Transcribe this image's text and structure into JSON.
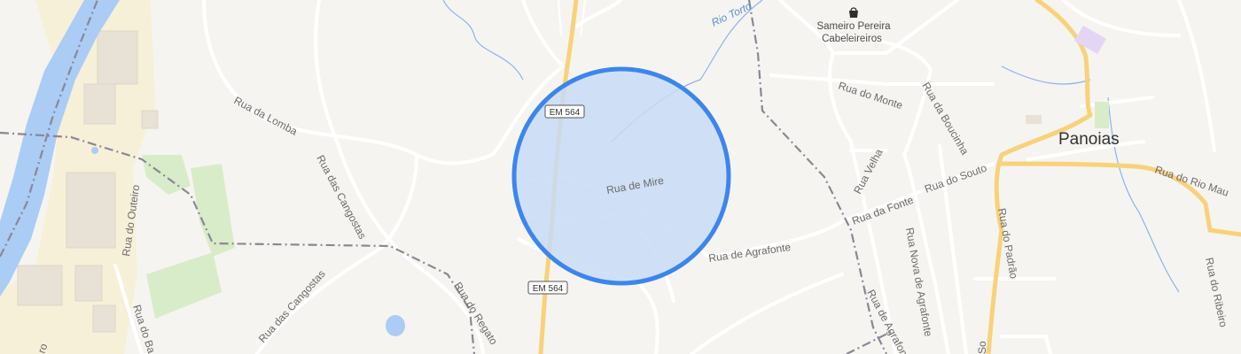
{
  "map": {
    "place_label": "Panoias",
    "poi": {
      "icon": "shopping-bag-icon",
      "name_line1": "Sameiro Pereira",
      "name_line2": "Cabeleireiros"
    },
    "road_shield": "EM 564",
    "water_label": "Rio Torto",
    "streets": {
      "rua_de_mire": "Rua de Mire",
      "rua_da_lomba": "Rua da Lomba",
      "rua_das_cangostas": "Rua das Cangostas",
      "rua_das_cangostas_2": "Rua das Cangostas",
      "rua_do_outeiro": "Rua do Outeiro",
      "rua_do_regato": "Rua do Regato",
      "rua_de_agrafonte": "Rua de Agrafonte",
      "rua_do_monte": "Rua do Monte",
      "rua_da_boucinha": "Rua da Boucinha",
      "rua_velha": "Rua Velha",
      "rua_da_fonte": "Rua da Fonte",
      "rua_do_souto": "Rua do Souto",
      "rua_nova_de_agrafonte": "Rua Nova de Agrafonte",
      "rua_do_padrao": "Rua do Padrão",
      "rua_do_rio_mau": "Rua do Rio Mau",
      "rua_do_ribeiro": "Rua do Ribeiro",
      "rua_de_agrafonte_2": "Rua de Agrafonte",
      "rua_do_ba": "Rua do Ba",
      "ro_edge": "ro",
      "so_edge": "So"
    },
    "colors": {
      "background": "#f6f4f0",
      "water": "#aaccf5",
      "highway": "#f7d27a",
      "park": "#d9ecca",
      "industrial": "#f7f0d8",
      "boundary": "#8b8795",
      "selection_fill": "#c8daf6",
      "selection_stroke": "#3b86ee"
    }
  }
}
